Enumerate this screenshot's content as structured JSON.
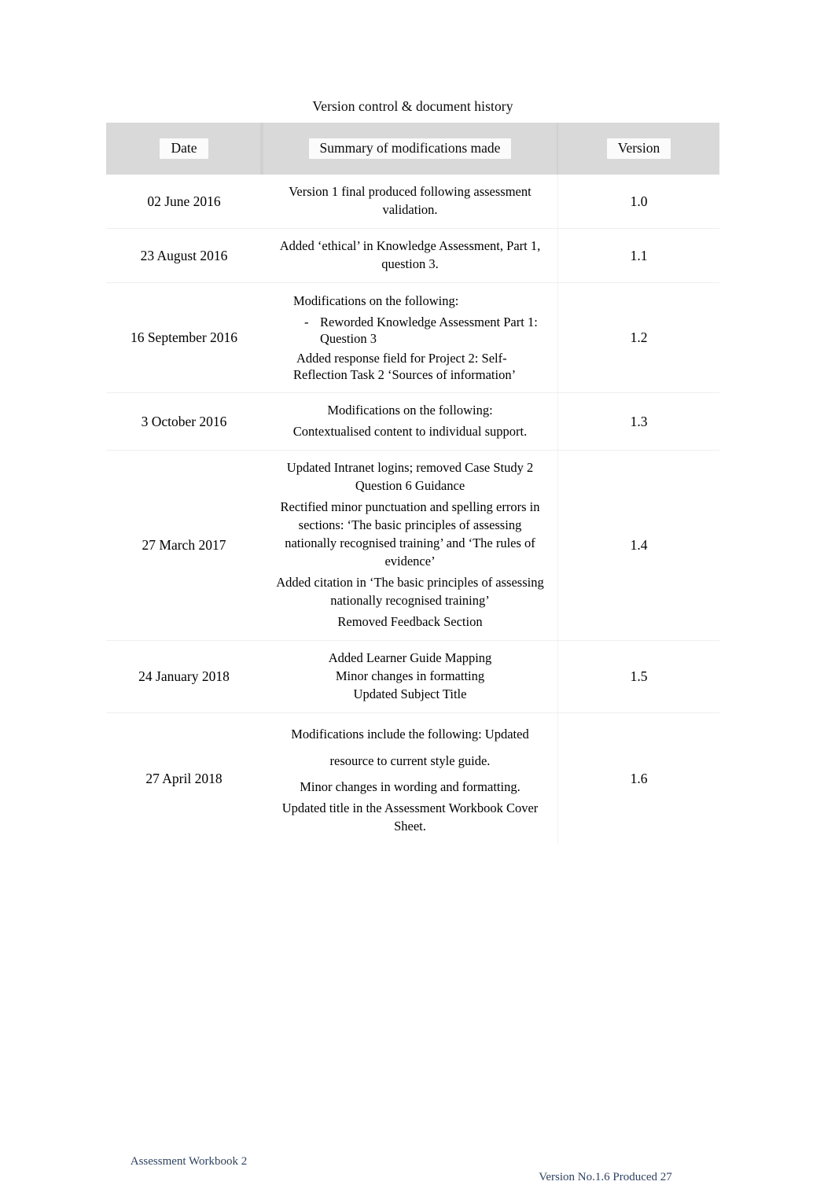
{
  "document": {
    "title": "Version control & document history"
  },
  "table": {
    "headers": {
      "date": "Date",
      "summary": "Summary of modifications made",
      "version": "Version"
    },
    "rows": [
      {
        "date": "02 June 2016",
        "version": "1.0",
        "summary": {
          "p1": "Version 1 final produced following assessment validation."
        }
      },
      {
        "date": "23 August 2016",
        "version": "1.1",
        "summary": {
          "p1": "Added ‘ethical’ in Knowledge Assessment, Part 1, question 3."
        }
      },
      {
        "date": "16 September 2016",
        "version": "1.2",
        "summary": {
          "p1": "Modifications on the following:",
          "bullet_dash": "-",
          "bullet1": "Reworded Knowledge Assessment Part 1: Question 3",
          "p2": "Added response field for Project 2: Self- Reflection Task 2 ‘Sources of information’"
        }
      },
      {
        "date": "3 October 2016",
        "version": "1.3",
        "summary": {
          "p1": "Modifications on the following:",
          "p2": "Contextualised content to individual support."
        }
      },
      {
        "date": "27 March 2017",
        "version": "1.4",
        "summary": {
          "p1": "Updated Intranet logins; removed Case Study 2 Question 6 Guidance",
          "p2": "Rectified minor punctuation and spelling errors in sections: ‘The basic principles of assessing nationally recognised training’ and ‘The rules of evidence’",
          "p3": "Added citation in ‘The basic principles of assessing nationally recognised training’",
          "p4": "Removed Feedback Section"
        }
      },
      {
        "date": "24 January 2018",
        "version": "1.5",
        "summary": {
          "p1": "Added Learner Guide Mapping Minor changes in formatting Updated Subject Title"
        }
      },
      {
        "date": "27 April 2018",
        "version": "1.6",
        "summary": {
          "p1": "Modifications include the following: Updated resource to current style guide.",
          "p2": "Minor changes in wording and formatting.",
          "p3": "Updated title in the Assessment Workbook Cover Sheet."
        }
      }
    ]
  },
  "footer": {
    "left": "Assessment Workbook 2",
    "right": "Version No.1.6 Produced 27",
    "color": "#2f4260"
  }
}
